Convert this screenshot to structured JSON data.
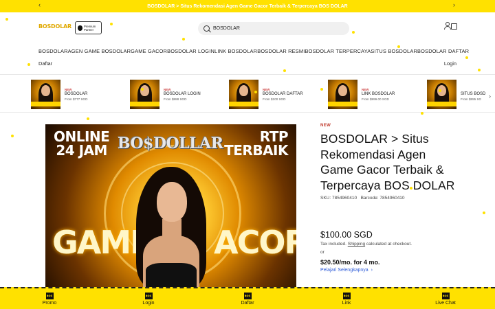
{
  "announcement": {
    "text": "BOSDOLAR > Situs Rekomendasi Agen Game Gacor Terbaik & Terpercaya BOS DOLAR",
    "prev": "‹",
    "next": "›"
  },
  "header": {
    "logo": "BOSDOLAR",
    "partner_line1": "Premium",
    "partner_line2": "Partner",
    "search_value": "BOSDOLAR"
  },
  "nav": {
    "items": [
      "BOSDOLAR",
      "AGEN GAME BOSDOLAR",
      "GAME GACOR",
      "BOSDOLAR LOGIN",
      "LINK BOSDOLAR",
      "BOSDOLAR RESMI",
      "BOSDOLAR TERPERCAYA",
      "SITUS BOSDOLAR",
      "BOSDOLAR DAFTAR"
    ],
    "daftar": "Daftar",
    "login": "Login"
  },
  "products": [
    {
      "badge": "NEW",
      "name": "BOSDOLAR",
      "price": "From $777 SGD"
    },
    {
      "badge": "NEW",
      "name": "BOSDOLAR LOGIN",
      "price": "From $888 SGD"
    },
    {
      "badge": "NEW",
      "name": "BOSDOLAR DAFTAR",
      "price": "From $100 SGD"
    },
    {
      "badge": "NEW",
      "name": "LINK BOSDOLAR",
      "price": "From $999.00 SGD"
    },
    {
      "badge": "",
      "name": "SITUS BOSD",
      "price": "From $555 SG"
    }
  ],
  "hero": {
    "line1": "ONLINE",
    "line2": "24 JAM",
    "brand": "BO$DOLLAR",
    "rtp1": "RTP",
    "rtp2": "TERBAIK",
    "word1": "GAME",
    "word2": "ACOR"
  },
  "product_info": {
    "badge": "NEW",
    "title": "BOSDOLAR > Situs Rekomendasi Agen Game Gacor Terbaik & Terpercaya BOS DOLAR",
    "sku": "SKU: 7854960410",
    "barcode": "Barcode: 7854960410",
    "price": "$100.00 SGD",
    "tax_prefix": "Tax included.",
    "tax_link": "Shipping",
    "tax_suffix": "calculated at checkout.",
    "or": "or",
    "installment": "$20.50/mo. for 4 mo.",
    "learn_more": "Pelajari Selengkapnya"
  },
  "bottom_nav": [
    {
      "icon": "BOS",
      "label": "Promo"
    },
    {
      "icon": "BOS",
      "label": "Login"
    },
    {
      "icon": "BOS",
      "label": "Daftar"
    },
    {
      "icon": "BOS",
      "label": "Link"
    },
    {
      "icon": "BOS",
      "label": "Live Chat"
    }
  ],
  "colors": {
    "accent": "#ffe100",
    "logo": "#e0a800",
    "link": "#2d5bd8",
    "badge": "#c0392b"
  }
}
